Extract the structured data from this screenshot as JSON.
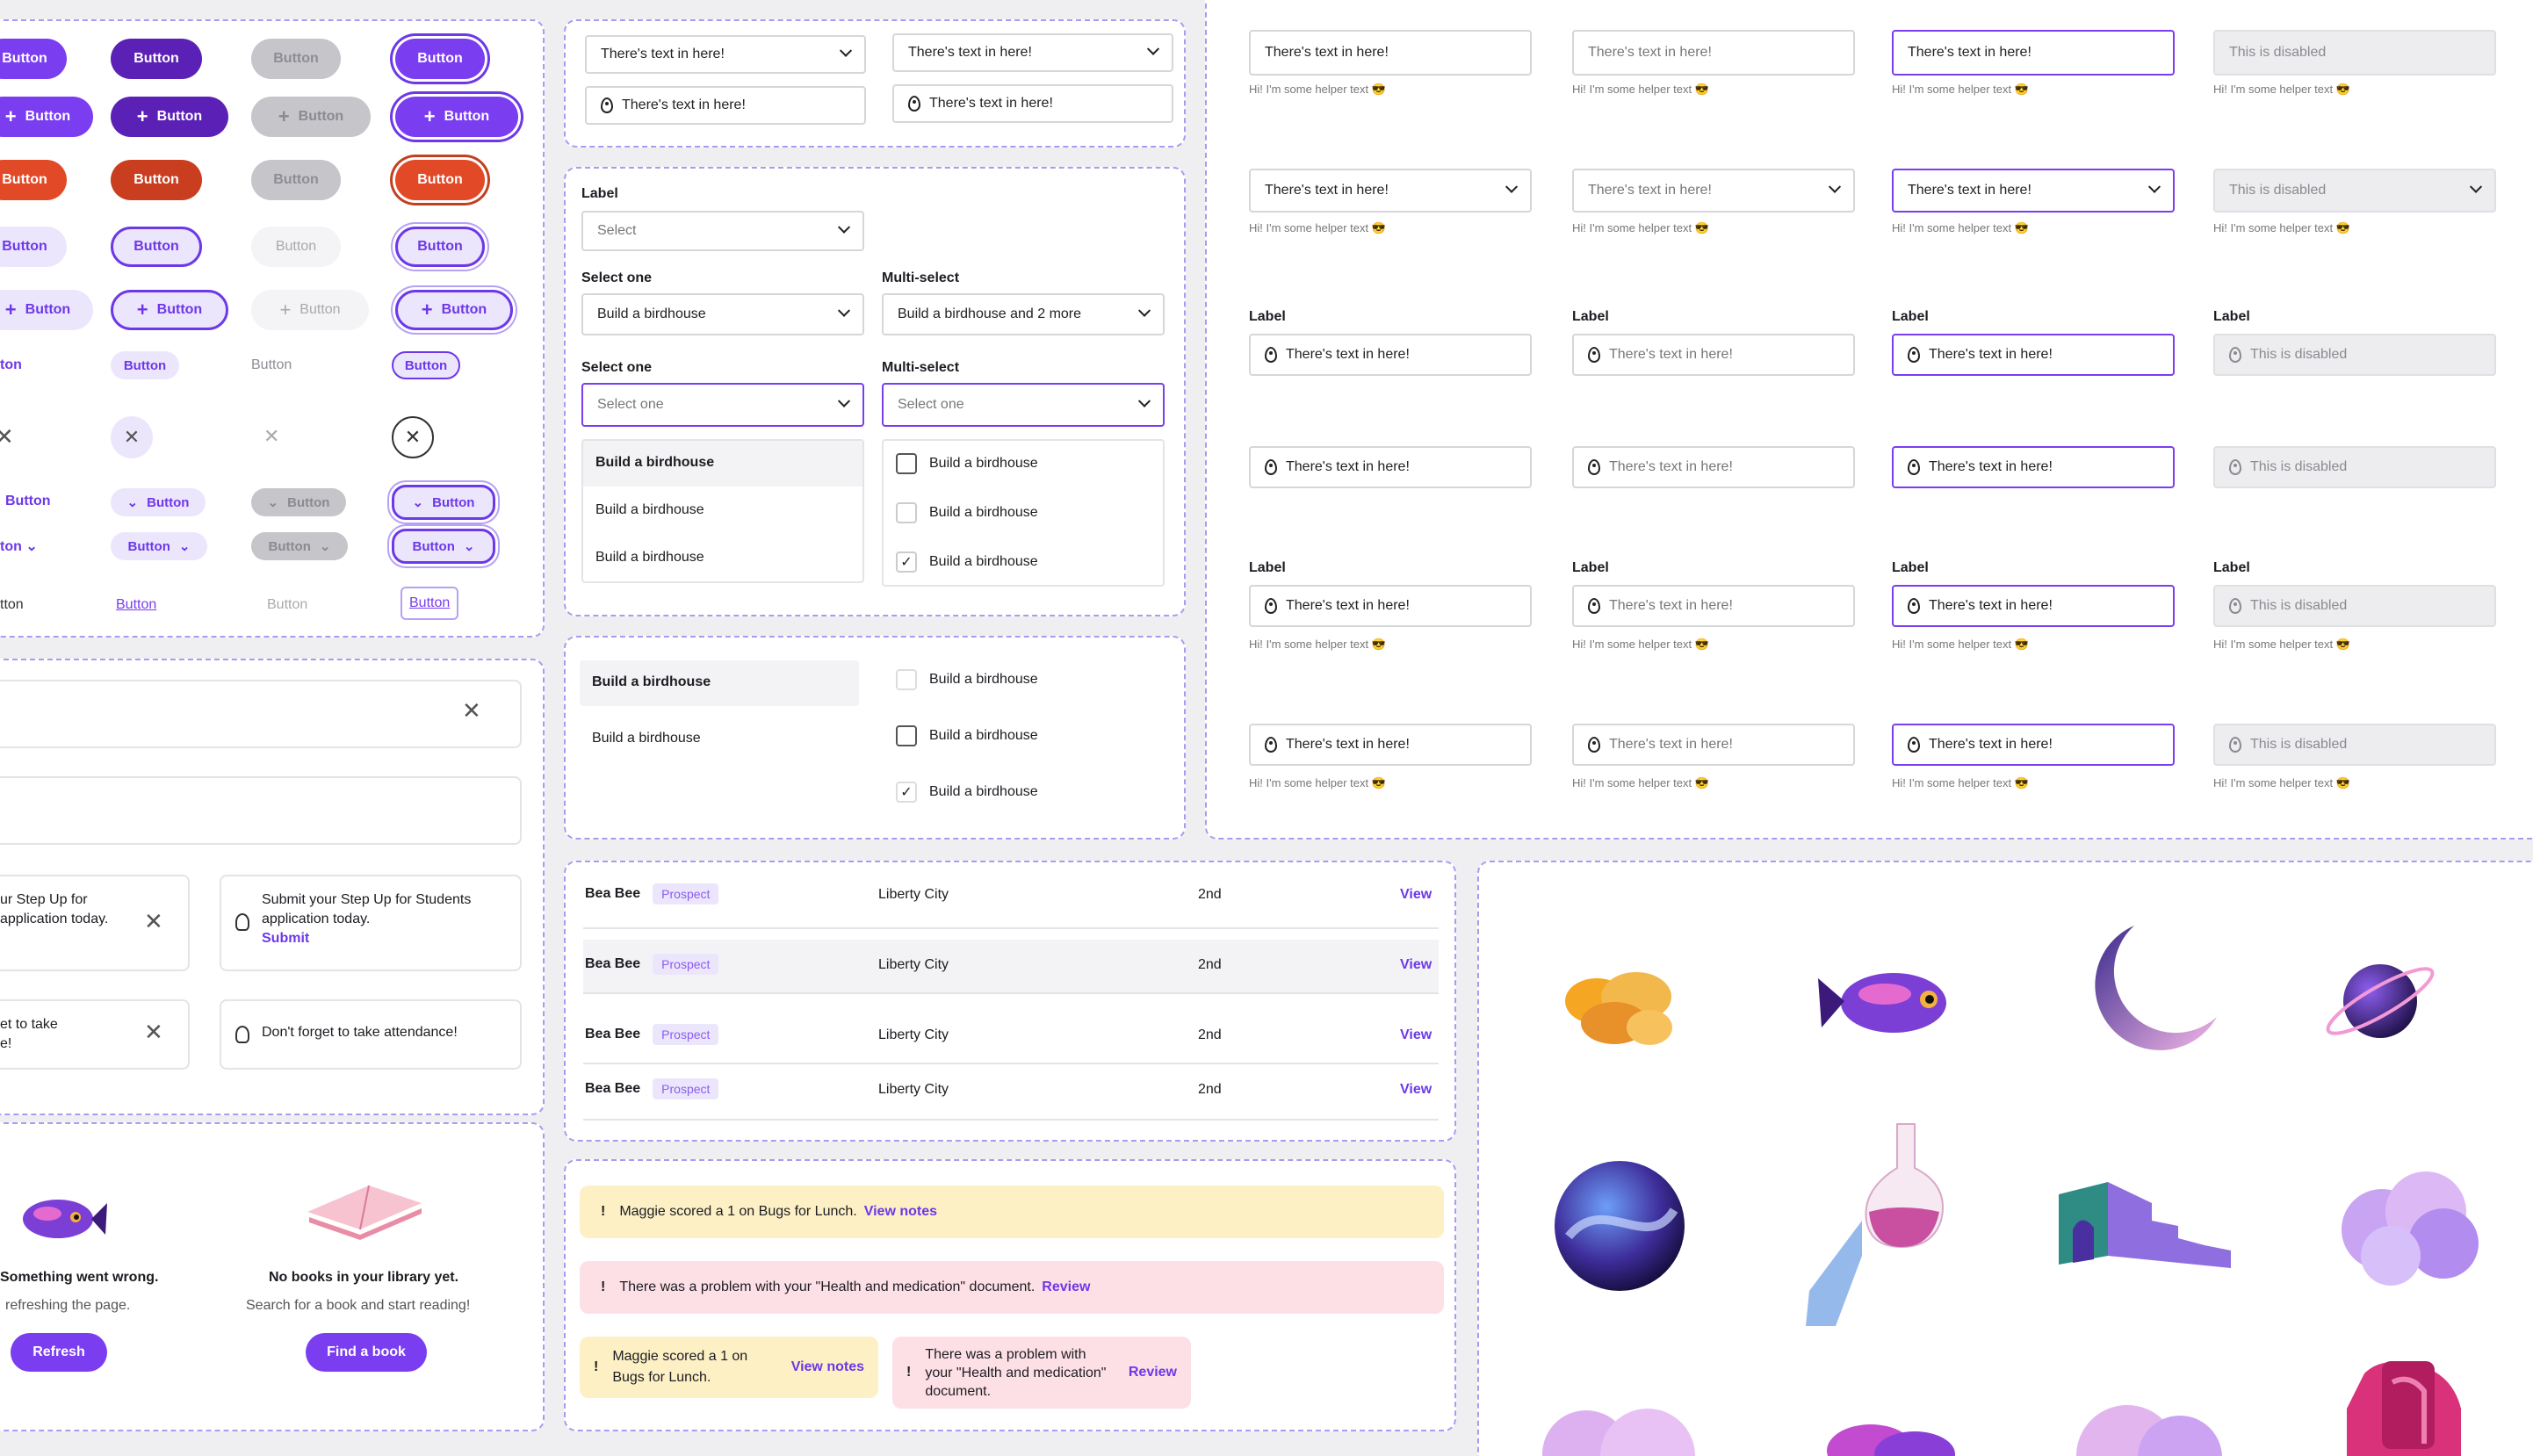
{
  "buttons": {
    "label": "Button",
    "partial_a": "Button",
    "partial_b": "Button",
    "partial_c": "utton",
    "partial_d": "ton",
    "partial_e": "tton"
  },
  "selects": {
    "value": "There's text in here!",
    "label": "Label",
    "select_placeholder": "Select",
    "select_one_label": "Select one",
    "multi_select_label": "Multi-select",
    "build": "Build a birdhouse",
    "build_more": "Build a birdhouse and 2 more",
    "select_one_placeholder": "Select one"
  },
  "inputs": {
    "value": "There's text in here!",
    "disabled": "This is disabled",
    "helper": "Hi! I'm some helper text 😎",
    "label": "Label"
  },
  "banners": {
    "step_up_partial": "ur Step Up for",
    "application_partial": "application today.",
    "step_up_full": "Submit your Step Up for Students",
    "application_today": "application today.",
    "submit": "Submit",
    "take_partial": "et to take",
    "take_partial2": "e!",
    "attendance": "Don't forget to take attendance!"
  },
  "empty_states": {
    "error_title": "Something went wrong.",
    "error_sub": "refreshing the page.",
    "refresh": "Refresh",
    "books_title": "No books in your library yet.",
    "books_sub": "Search for a book and start reading!",
    "find_book": "Find a book"
  },
  "table": {
    "rows": [
      {
        "name": "Bea Bee",
        "badge": "Prospect",
        "city": "Liberty City",
        "grade": "2nd",
        "action": "View"
      },
      {
        "name": "Bea Bee",
        "badge": "Prospect",
        "city": "Liberty City",
        "grade": "2nd",
        "action": "View"
      },
      {
        "name": "Bea Bee",
        "badge": "Prospect",
        "city": "Liberty City",
        "grade": "2nd",
        "action": "View"
      },
      {
        "name": "Bea Bee",
        "badge": "Prospect",
        "city": "Liberty City",
        "grade": "2nd",
        "action": "View"
      }
    ]
  },
  "alerts": {
    "maggie": "Maggie scored a 1 on Bugs for Lunch.",
    "view_notes": "View notes",
    "problem": "There was a problem with your \"Health and medication\" document.",
    "review": "Review",
    "maggie_l1": "Maggie scored a 1 on",
    "maggie_l2": "Bugs for Lunch.",
    "problem_l1": "There was a problem with",
    "problem_l2": "your \"Health and medication\"",
    "problem_l3": "document."
  },
  "colors": {
    "primary": "#7a3df0",
    "primary_dark": "#5b21b6",
    "danger": "#e24a27",
    "warning_bg": "#fdf0c5",
    "error_bg": "#fde0e6",
    "panel_border": "#a79df0"
  },
  "icons": [
    "plus-icon",
    "close-icon",
    "chevron-down-icon",
    "map-pin-icon",
    "lightbulb-icon",
    "checkmark-icon",
    "exclamation-icon"
  ]
}
